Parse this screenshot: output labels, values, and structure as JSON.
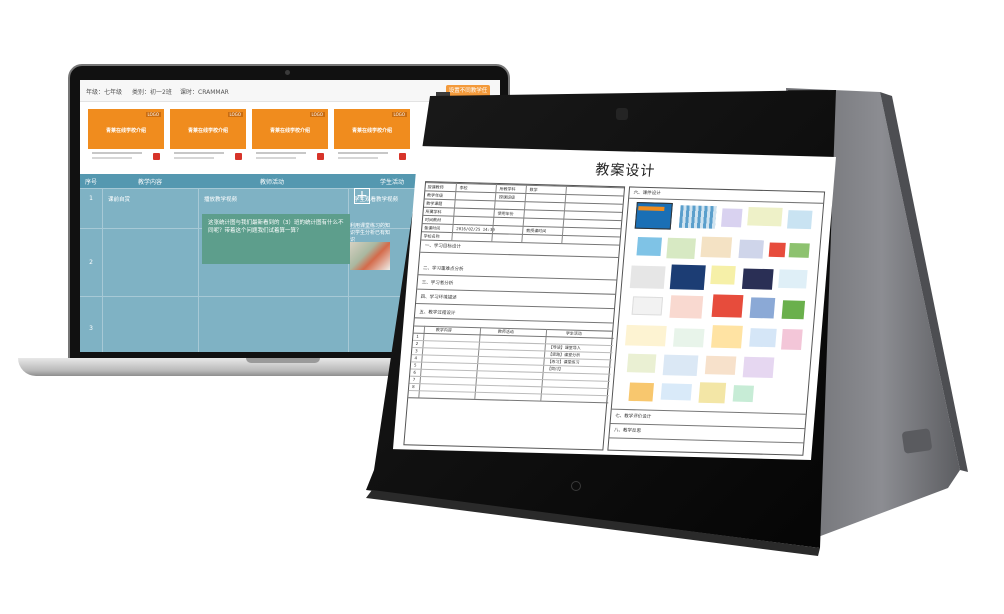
{
  "laptop": {
    "meta": {
      "grade": "年级：七年级",
      "course": "类别：初一2班",
      "lesson": "课时：CRAMMAR"
    },
    "action_button": "设置不同教学任",
    "cards": [
      {
        "logo": "LOGO",
        "title": "青莱在线学校介绍"
      },
      {
        "logo": "LOGO",
        "title": "青莱在线学校介绍"
      },
      {
        "logo": "LOGO",
        "title": "青莱在线学校介绍"
      },
      {
        "logo": "LOGO",
        "title": "青莱在线学校介绍"
      }
    ],
    "table": {
      "headers": [
        "序号",
        "教学内容",
        "教师活动",
        "学生活动"
      ],
      "rows": [
        {
          "num": "1",
          "content": "课前自赏",
          "teacher": "播放教学视频",
          "student": "学生观看教学视频"
        },
        {
          "num": "2",
          "content": "",
          "teacher": "",
          "student": ""
        },
        {
          "num": "3",
          "content": "",
          "teacher": "",
          "student": ""
        }
      ],
      "note": "这张统计图与我们最新看到的（3）班的统计图有什么不同呢？带着这个问题我们试着算一算？",
      "student_note": "利用课堂练习的知识学生分析已有知识"
    }
  },
  "tablet": {
    "doc": {
      "title": "教案设计",
      "left_form": {
        "row1": [
          "授课教师",
          "李校",
          "所教学科",
          "数学"
        ],
        "row2": [
          "教学年级",
          "",
          "授课班级",
          ""
        ],
        "row3": [
          "教学课题",
          ""
        ],
        "row4": [
          "所属学科",
          "",
          "使用年份",
          ""
        ],
        "row5": [
          "时间教材",
          ""
        ],
        "row6": [
          "备课时间",
          "2016/02/25 14:39",
          "教授课时间",
          ""
        ],
        "row7": [
          "学校名称",
          ""
        ],
        "sections": [
          "一、学习目标设计",
          "二、学习重难点分析",
          "三、学习者分析",
          "四、学习环境描述",
          "五、教学过程设计"
        ],
        "process_headers": [
          "教学内容",
          "教师活动",
          "学生活动"
        ],
        "process_items": [
          "【导读】课堂导入",
          "【思路】课堂分析",
          "【练习】课堂练习",
          "【同讨】"
        ],
        "process_nums": [
          "1",
          "2",
          "3",
          "4",
          "5",
          "6",
          "7",
          "8"
        ]
      },
      "right_form": {
        "sections": [
          "六、课件设计",
          "七、教学评价设计",
          "八、教学反思"
        ]
      }
    }
  }
}
